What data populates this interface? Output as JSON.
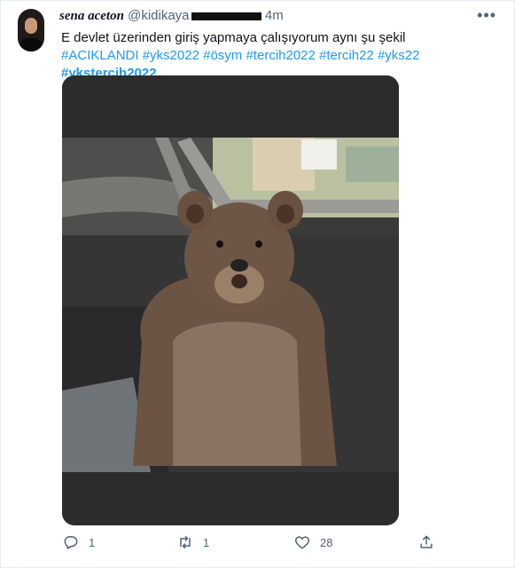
{
  "tweet": {
    "author_name": "sena aceton",
    "handle": "@kidikaya",
    "time": "4m",
    "text": "E devlet üzerinden giriş yapmaya çalışıyorum aynı şu şekil",
    "hashtags": [
      "#ACIKLANDI",
      "#yks2022",
      "#ösym",
      "#tercih2022",
      "#tercih22",
      "#yks22",
      "#ykstercih2022"
    ]
  },
  "icons": {
    "more": "more-horizontal-icon",
    "reply": "reply-icon",
    "retweet": "retweet-icon",
    "like": "heart-icon",
    "share": "share-icon"
  },
  "stats": {
    "replies": "1",
    "retweets": "1",
    "likes": "28"
  },
  "colors": {
    "link": "#1d9bf0",
    "secondary": "#536471",
    "text": "#0f1419"
  }
}
